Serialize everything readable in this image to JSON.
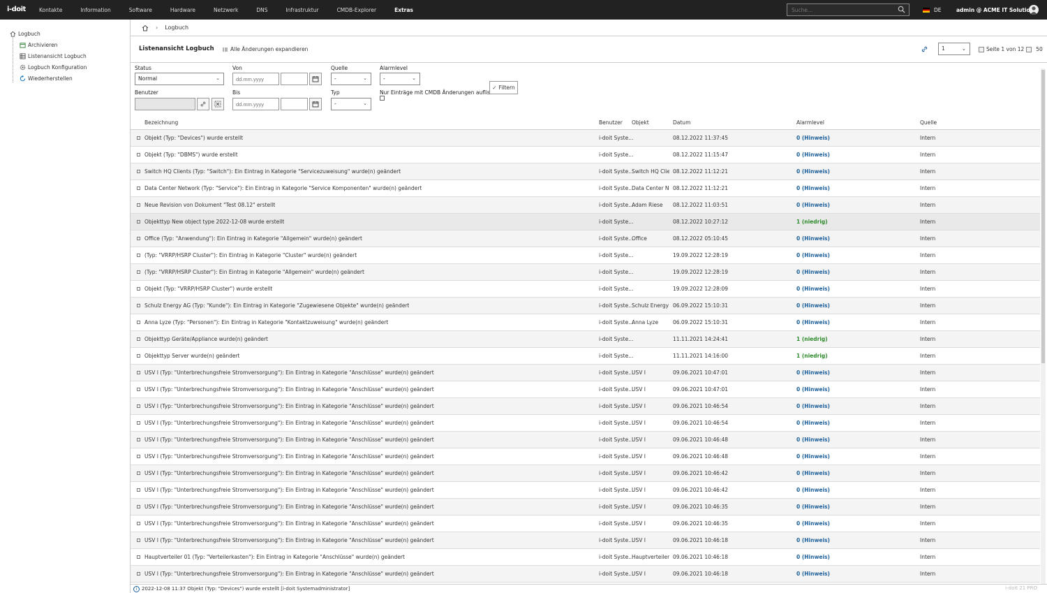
{
  "app": {
    "logo": "i-doit"
  },
  "nav": {
    "items": [
      {
        "label": "Kontakte",
        "active": false
      },
      {
        "label": "Information",
        "active": false
      },
      {
        "label": "Software",
        "active": false
      },
      {
        "label": "Hardware",
        "active": false
      },
      {
        "label": "Netzwerk",
        "active": false
      },
      {
        "label": "DNS",
        "active": false
      },
      {
        "label": "Infrastruktur",
        "active": false
      },
      {
        "label": "CMDB-Explorer",
        "active": false
      },
      {
        "label": "Extras",
        "active": true
      }
    ]
  },
  "search": {
    "placeholder": "Suche..."
  },
  "lang": "DE",
  "user": "admin @ ACME IT Solutions",
  "sidebar": {
    "root": "Logbuch",
    "items": [
      "Archivieren",
      "Listenansicht Logbuch",
      "Logbuch Konfiguration",
      "Wiederherstellen"
    ]
  },
  "breadcrumb": {
    "current": "Logbuch"
  },
  "header": {
    "title": "Listenansicht Logbuch",
    "expand": "Alle Änderungen expandieren",
    "page_value": "1",
    "page_info": "Seite 1 von 12",
    "per_page": "50"
  },
  "filters": {
    "status_label": "Status",
    "status_value": "Normal",
    "von_label": "Von",
    "von_placeholder": "dd.mm.yyyy",
    "quelle_label": "Quelle",
    "quelle_value": "-",
    "alarm_label": "Alarmlevel",
    "alarm_value": "-",
    "benutzer_label": "Benutzer",
    "bis_label": "Bis",
    "bis_placeholder": "dd.mm.yyyy",
    "typ_label": "Typ",
    "typ_value": "-",
    "cmdb_label": "Nur Einträge mit CMDB Änderungen auflisten",
    "filter_button": "Filtern"
  },
  "table": {
    "columns": [
      "Bezeichnung",
      "Benutzer",
      "Objekt",
      "Datum",
      "Alarmlevel",
      "Quelle"
    ],
    "rows": [
      {
        "bez": "Objekt (Typ: \"Devices\") wurde erstellt",
        "user": "i-doit Syste...",
        "obj": "",
        "date": "08.12.2022 11:37:45",
        "alarm": "0 (Hinweis)",
        "level": 0,
        "src": "Intern"
      },
      {
        "bez": "Objekt (Typ: \"DBMS\") wurde erstellt",
        "user": "i-doit Syste...",
        "obj": "",
        "date": "08.12.2022 11:15:47",
        "alarm": "0 (Hinweis)",
        "level": 0,
        "src": "Intern"
      },
      {
        "bez": "Switch HQ Clients (Typ: \"Switch\"): Ein Eintrag in Kategorie \"Servicezuweisung\" wurde(n) geändert",
        "user": "i-doit Syste...",
        "obj": "Switch HQ Clie...",
        "date": "08.12.2022 11:12:21",
        "alarm": "0 (Hinweis)",
        "level": 0,
        "src": "Intern"
      },
      {
        "bez": "Data Center Network (Typ: \"Service\"): Ein Eintrag in Kategorie \"Service Komponenten\" wurde(n) geändert",
        "user": "i-doit Syste...",
        "obj": "Data Center N...",
        "date": "08.12.2022 11:12:21",
        "alarm": "0 (Hinweis)",
        "level": 0,
        "src": "Intern"
      },
      {
        "bez": "Neue Revision von Dokument \"Test 08.12\" erstellt",
        "user": "i-doit Syste...",
        "obj": "Adam Riese",
        "date": "08.12.2022 11:03:51",
        "alarm": "0 (Hinweis)",
        "level": 0,
        "src": "Intern"
      },
      {
        "bez": "Objekttyp New object type 2022-12-08 wurde erstellt",
        "user": "i-doit Syste...",
        "obj": "",
        "date": "08.12.2022 10:27:12",
        "alarm": "1 (niedrig)",
        "level": 1,
        "src": "Intern"
      },
      {
        "bez": "Office (Typ: \"Anwendung\"): Ein Eintrag in Kategorie \"Allgemein\" wurde(n) geändert",
        "user": "i-doit Syste...",
        "obj": "Office",
        "date": "08.12.2022 05:10:45",
        "alarm": "0 (Hinweis)",
        "level": 0,
        "src": "Intern"
      },
      {
        "bez": "(Typ: \"VRRP/HSRP Cluster\"): Ein Eintrag in Kategorie \"Cluster\" wurde(n) geändert",
        "user": "i-doit Syste...",
        "obj": "",
        "date": "19.09.2022 12:28:19",
        "alarm": "0 (Hinweis)",
        "level": 0,
        "src": "Intern"
      },
      {
        "bez": "(Typ: \"VRRP/HSRP Cluster\"): Ein Eintrag in Kategorie \"Allgemein\" wurde(n) geändert",
        "user": "i-doit Syste...",
        "obj": "",
        "date": "19.09.2022 12:28:19",
        "alarm": "0 (Hinweis)",
        "level": 0,
        "src": "Intern"
      },
      {
        "bez": "Objekt (Typ: \"VRRP/HSRP Cluster\") wurde erstellt",
        "user": "i-doit Syste...",
        "obj": "",
        "date": "19.09.2022 12:28:09",
        "alarm": "0 (Hinweis)",
        "level": 0,
        "src": "Intern"
      },
      {
        "bez": "Schulz Energy AG (Typ: \"Kunde\"): Ein Eintrag in Kategorie \"Zugewiesene Objekte\" wurde(n) geändert",
        "user": "i-doit Syste...",
        "obj": "Schulz Energy ...",
        "date": "06.09.2022 15:10:31",
        "alarm": "0 (Hinweis)",
        "level": 0,
        "src": "Intern"
      },
      {
        "bez": "Anna Lyze (Typ: \"Personen\"): Ein Eintrag in Kategorie \"Kontaktzuweisung\" wurde(n) geändert",
        "user": "i-doit Syste...",
        "obj": "Anna Lyze",
        "date": "06.09.2022 15:10:31",
        "alarm": "0 (Hinweis)",
        "level": 0,
        "src": "Intern"
      },
      {
        "bez": "Objekttyp Geräte/Appliance wurde(n) geändert",
        "user": "i-doit Syste...",
        "obj": "",
        "date": "11.11.2021 14:24:41",
        "alarm": "1 (niedrig)",
        "level": 1,
        "src": "Intern"
      },
      {
        "bez": "Objekttyp Server wurde(n) geändert",
        "user": "i-doit Syste...",
        "obj": "",
        "date": "11.11.2021 14:16:00",
        "alarm": "1 (niedrig)",
        "level": 1,
        "src": "Intern"
      },
      {
        "bez": "USV I (Typ: \"Unterbrechungsfreie Stromversorgung\"): Ein Eintrag in Kategorie \"Anschlüsse\" wurde(n) geändert",
        "user": "i-doit Syste...",
        "obj": "USV I",
        "date": "09.06.2021 10:47:01",
        "alarm": "0 (Hinweis)",
        "level": 0,
        "src": "Intern"
      },
      {
        "bez": "USV I (Typ: \"Unterbrechungsfreie Stromversorgung\"): Ein Eintrag in Kategorie \"Anschlüsse\" wurde(n) geändert",
        "user": "i-doit Syste...",
        "obj": "USV I",
        "date": "09.06.2021 10:47:01",
        "alarm": "0 (Hinweis)",
        "level": 0,
        "src": "Intern"
      },
      {
        "bez": "USV I (Typ: \"Unterbrechungsfreie Stromversorgung\"): Ein Eintrag in Kategorie \"Anschlüsse\" wurde(n) geändert",
        "user": "i-doit Syste...",
        "obj": "USV I",
        "date": "09.06.2021 10:46:54",
        "alarm": "0 (Hinweis)",
        "level": 0,
        "src": "Intern"
      },
      {
        "bez": "USV I (Typ: \"Unterbrechungsfreie Stromversorgung\"): Ein Eintrag in Kategorie \"Anschlüsse\" wurde(n) geändert",
        "user": "i-doit Syste...",
        "obj": "USV I",
        "date": "09.06.2021 10:46:54",
        "alarm": "0 (Hinweis)",
        "level": 0,
        "src": "Intern"
      },
      {
        "bez": "USV I (Typ: \"Unterbrechungsfreie Stromversorgung\"): Ein Eintrag in Kategorie \"Anschlüsse\" wurde(n) geändert",
        "user": "i-doit Syste...",
        "obj": "USV I",
        "date": "09.06.2021 10:46:48",
        "alarm": "0 (Hinweis)",
        "level": 0,
        "src": "Intern"
      },
      {
        "bez": "USV I (Typ: \"Unterbrechungsfreie Stromversorgung\"): Ein Eintrag in Kategorie \"Anschlüsse\" wurde(n) geändert",
        "user": "i-doit Syste...",
        "obj": "USV I",
        "date": "09.06.2021 10:46:48",
        "alarm": "0 (Hinweis)",
        "level": 0,
        "src": "Intern"
      },
      {
        "bez": "USV I (Typ: \"Unterbrechungsfreie Stromversorgung\"): Ein Eintrag in Kategorie \"Anschlüsse\" wurde(n) geändert",
        "user": "i-doit Syste...",
        "obj": "USV I",
        "date": "09.06.2021 10:46:42",
        "alarm": "0 (Hinweis)",
        "level": 0,
        "src": "Intern"
      },
      {
        "bez": "USV I (Typ: \"Unterbrechungsfreie Stromversorgung\"): Ein Eintrag in Kategorie \"Anschlüsse\" wurde(n) geändert",
        "user": "i-doit Syste...",
        "obj": "USV I",
        "date": "09.06.2021 10:46:42",
        "alarm": "0 (Hinweis)",
        "level": 0,
        "src": "Intern"
      },
      {
        "bez": "USV I (Typ: \"Unterbrechungsfreie Stromversorgung\"): Ein Eintrag in Kategorie \"Anschlüsse\" wurde(n) geändert",
        "user": "i-doit Syste...",
        "obj": "USV I",
        "date": "09.06.2021 10:46:35",
        "alarm": "0 (Hinweis)",
        "level": 0,
        "src": "Intern"
      },
      {
        "bez": "USV I (Typ: \"Unterbrechungsfreie Stromversorgung\"): Ein Eintrag in Kategorie \"Anschlüsse\" wurde(n) geändert",
        "user": "i-doit Syste...",
        "obj": "USV I",
        "date": "09.06.2021 10:46:35",
        "alarm": "0 (Hinweis)",
        "level": 0,
        "src": "Intern"
      },
      {
        "bez": "USV I (Typ: \"Unterbrechungsfreie Stromversorgung\"): Ein Eintrag in Kategorie \"Anschlüsse\" wurde(n) geändert",
        "user": "i-doit Syste...",
        "obj": "USV I",
        "date": "09.06.2021 10:46:18",
        "alarm": "0 (Hinweis)",
        "level": 0,
        "src": "Intern"
      },
      {
        "bez": "Hauptverteiler 01 (Typ: \"Verteilerkasten\"): Ein Eintrag in Kategorie \"Anschlüsse\" wurde(n) geändert",
        "user": "i-doit Syste...",
        "obj": "Hauptverteiler ...",
        "date": "09.06.2021 10:46:18",
        "alarm": "0 (Hinweis)",
        "level": 0,
        "src": "Intern"
      },
      {
        "bez": "USV I (Typ: \"Unterbrechungsfreie Stromversorgung\"): Ein Eintrag in Kategorie \"Anschlüsse\" wurde(n) geändert",
        "user": "i-doit Syste...",
        "obj": "USV I",
        "date": "09.06.2021 10:46:18",
        "alarm": "0 (Hinweis)",
        "level": 0,
        "src": "Intern"
      }
    ]
  },
  "statusbar": {
    "message": "2022-12-08 11:37 Objekt (Typ: \"Devices\") wurde erstellt [i-doit Systemadministrator]",
    "version": "i-doit 21 PRO"
  },
  "colors": {
    "topbar": "#222222",
    "alarm_hinweis": "#1c5f9a",
    "alarm_niedrig": "#2e8b2e"
  }
}
